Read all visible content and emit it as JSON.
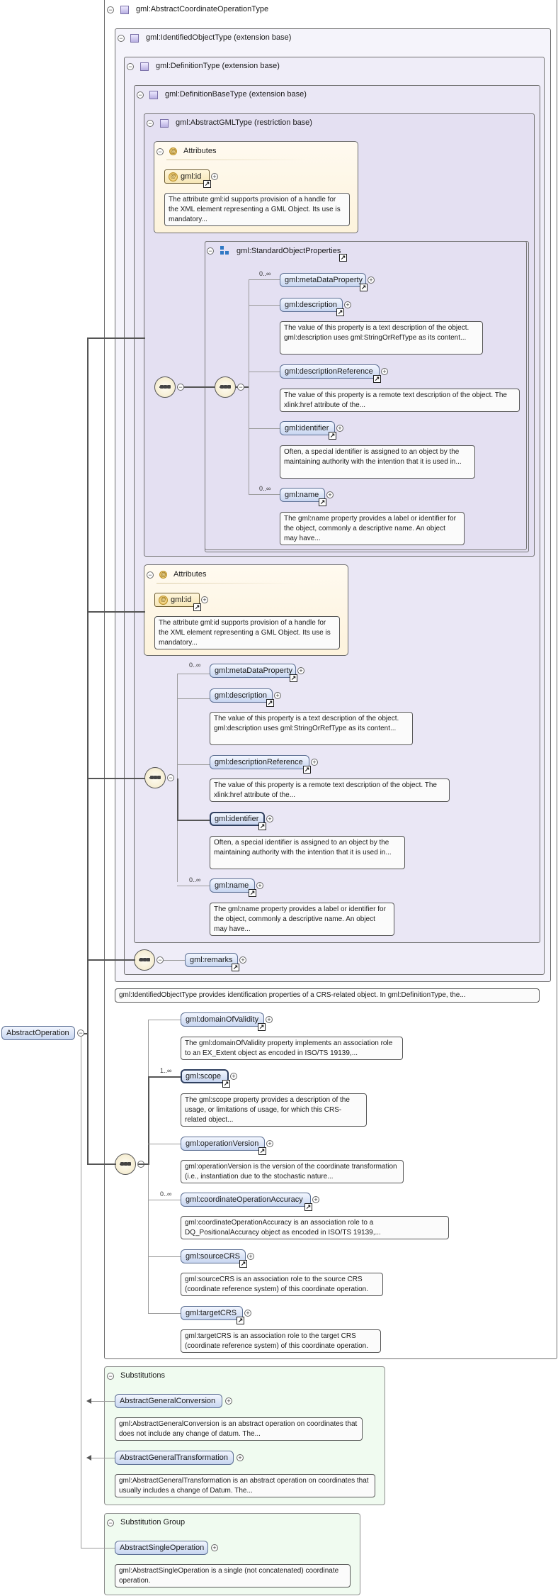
{
  "root": {
    "label": "AbstractOperation"
  },
  "type_frames": {
    "abstract_coordinate_operation_type": "gml:AbstractCoordinateOperationType",
    "identified_object_type": "gml:IdentifiedObjectType (extension base)",
    "definition_type": "gml:DefinitionType (extension base)",
    "definition_base_type": "gml:DefinitionBaseType (extension base)",
    "abstract_gml_type": "gml:AbstractGMLType (restriction base)"
  },
  "attributes_label": "Attributes",
  "gml_id": {
    "label": "gml:id",
    "doc": "The attribute gml:id supports provision of a handle for the XML element representing a GML Object. Its use is mandatory..."
  },
  "standard_object_properties": {
    "label": "gml:StandardObjectProperties"
  },
  "std_elements": {
    "meta_data_property": {
      "label": "gml:metaDataProperty",
      "card": "0..∞"
    },
    "description": {
      "label": "gml:description",
      "doc": "The value of this property is a text description of the object. gml:description uses gml:StringOrRefType as its content..."
    },
    "description_reference": {
      "label": "gml:descriptionReference",
      "doc": "The value of this property is a remote text description of the object. The xlink:href attribute of the..."
    },
    "identifier": {
      "label": "gml:identifier",
      "doc": "Often, a special identifier is assigned to an object by the maintaining authority with the intention that it is used in..."
    },
    "name": {
      "label": "gml:name",
      "card": "0..∞",
      "doc": "The gml:name property provides a label or identifier for the object, commonly a descriptive name. An object may have..."
    }
  },
  "remarks": {
    "label": "gml:remarks"
  },
  "identified_object_doc": "gml:IdentifiedObjectType provides identification properties of a CRS-related object. In gml:DefinitionType, the...",
  "operation_elements": {
    "domain_of_validity": {
      "label": "gml:domainOfValidity",
      "doc": "The gml:domainOfValidity property implements an association role to an EX_Extent object as encoded in ISO/TS 19139,..."
    },
    "scope": {
      "label": "gml:scope",
      "card": "1..∞",
      "doc": "The gml:scope property provides a description of the usage, or limitations of usage, for which this CRS-related object..."
    },
    "operation_version": {
      "label": "gml:operationVersion",
      "doc": "gml:operationVersion is the version of the coordinate transformation (i.e., instantiation due to the stochastic nature..."
    },
    "coordinate_operation_accuracy": {
      "label": "gml:coordinateOperationAccuracy",
      "card": "0..∞",
      "doc": "gml:coordinateOperationAccuracy is an association role to a DQ_PositionalAccuracy object as encoded in ISO/TS 19139,..."
    },
    "source_crs": {
      "label": "gml:sourceCRS",
      "doc": "gml:sourceCRS is an association role to the source CRS (coordinate reference system) of this coordinate operation."
    },
    "target_crs": {
      "label": "gml:targetCRS",
      "doc": "gml:targetCRS is an association role to the target CRS (coordinate reference system) of this coordinate operation."
    }
  },
  "substitutions": {
    "title": "Substitutions",
    "items": [
      {
        "label": "AbstractGeneralConversion",
        "doc": "gml:AbstractGeneralConversion is an abstract operation on coordinates that does not include any change of datum. The..."
      },
      {
        "label": "AbstractGeneralTransformation",
        "doc": "gml:AbstractGeneralTransformation is an abstract operation on coordinates that usually includes a change of Datum. The..."
      }
    ]
  },
  "substitution_group": {
    "title": "Substitution Group",
    "item": {
      "label": "AbstractSingleOperation",
      "doc": "gml:AbstractSingleOperation is a single (not concatenated) coordinate operation."
    }
  },
  "icons": {
    "collapse": "minus-sign",
    "expand": "plus-sign",
    "jump": "arrow-up-right",
    "complex_type": "lavender-square",
    "attribute": "at-sign"
  },
  "colors": {
    "element_fill": "#c7d5f0",
    "attribute_fill": "#fdf3dc",
    "type_frame_fill": "#e9e6f4",
    "substitutions_fill": "#f0fbf0"
  }
}
